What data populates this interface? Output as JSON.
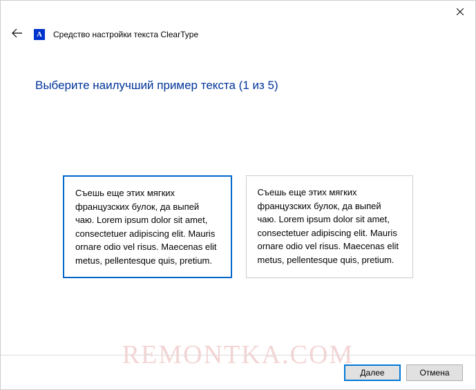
{
  "window": {
    "title": "Средство настройки текста ClearType",
    "icon_letter": "A"
  },
  "heading": "Выберите наилучший пример текста (1 из 5)",
  "samples": [
    {
      "text": "Съешь еще этих мягких французских булок, да выпей чаю. Lorem ipsum dolor sit amet, consectetuer adipiscing elit. Mauris ornare odio vel risus. Maecenas elit metus, pellentesque quis, pretium.",
      "selected": true
    },
    {
      "text": "Съешь еще этих мягких французских булок, да выпей чаю. Lorem ipsum dolor sit amet, consectetuer adipiscing elit. Mauris ornare odio vel risus. Maecenas elit metus, pellentesque quis, pretium.",
      "selected": false
    }
  ],
  "buttons": {
    "next": "Далее",
    "cancel": "Отмена"
  },
  "watermark": "REMONTKA.COM"
}
